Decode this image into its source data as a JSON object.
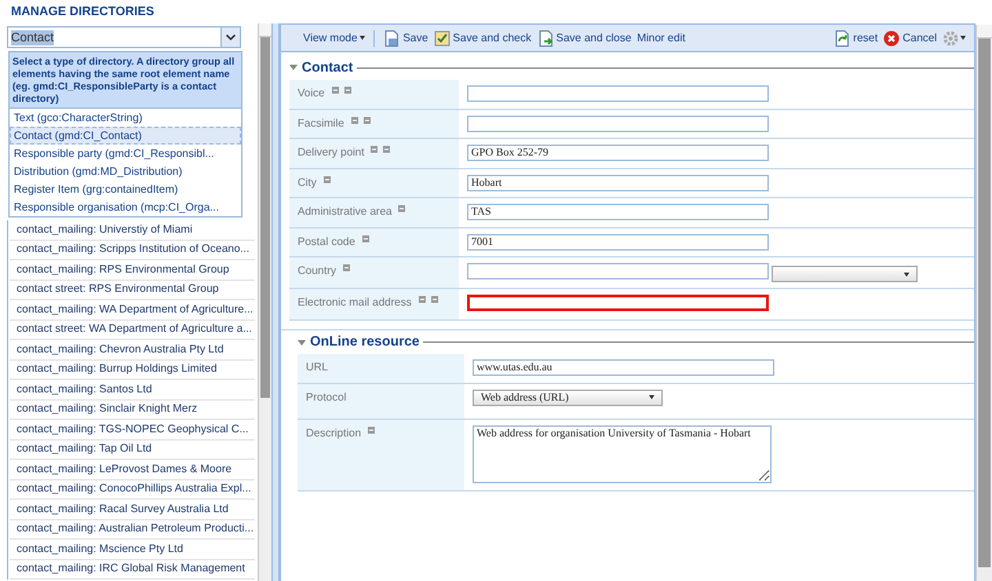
{
  "page_title": "MANAGE DIRECTORIES",
  "directory_type": {
    "value": "Contact",
    "hint": "Select a type of directory. A directory group all elements having the same root element name (eg. gmd:CI_ResponsibleParty is a contact directory)",
    "options": [
      {
        "label": "Text (gco:CharacterString)",
        "selected": false
      },
      {
        "label": "Contact (gmd:CI_Contact)",
        "selected": true
      },
      {
        "label": "Responsible party (gmd:CI_Responsibl...",
        "selected": false
      },
      {
        "label": "Distribution (gmd:MD_Distribution)",
        "selected": false
      },
      {
        "label": "Register Item (grg:containedItem)",
        "selected": false
      },
      {
        "label": "Responsible organisation (mcp:CI_Orga...",
        "selected": false
      }
    ]
  },
  "entries": [
    "contact_mailing: Universtiy of Miami",
    "contact_mailing: Scripps Institution of Oceano...",
    "contact_mailing: RPS Environmental Group",
    "contact street: RPS Environmental Group",
    "contact_mailing: WA Department of Agriculture...",
    "contact street: WA Department of Agriculture a...",
    "contact_mailing: Chevron Australia Pty Ltd",
    "contact_mailing: Burrup Holdings Limited",
    "contact_mailing: Santos Ltd",
    "contact_mailing: Sinclair Knight Merz",
    "contact_mailing: TGS-NOPEC Geophysical C...",
    "contact_mailing: Tap Oil Ltd",
    "contact_mailing: LeProvost Dames & Moore",
    "contact_mailing: ConocoPhillips Australia Expl...",
    "contact_mailing: Racal Survey Australia Ltd",
    "contact_mailing: Australian Petroleum Producti...",
    "contact_mailing: Mscience Pty Ltd",
    "contact_mailing: IRC Global Risk Management"
  ],
  "toolbar": {
    "view_mode": "View mode",
    "save": "Save",
    "save_and_check": "Save and check",
    "save_and_close": "Save and close",
    "minor_edit": "Minor edit",
    "reset": "reset",
    "cancel": "Cancel"
  },
  "sections": [
    {
      "title": "Contact",
      "expanded": true,
      "fields": [
        {
          "kind": "text",
          "label": "Voice",
          "can_add": true,
          "can_remove": true,
          "invalid": false
        },
        {
          "kind": "text",
          "label": "Facsimile",
          "can_add": true,
          "can_remove": true,
          "invalid": false
        },
        {
          "kind": "text",
          "label": "Delivery point",
          "value": "GPO Box 252-79",
          "can_add": true,
          "can_remove": true,
          "invalid": false
        },
        {
          "kind": "text",
          "label": "City",
          "value": "Hobart",
          "can_add": false,
          "can_remove": true,
          "invalid": false
        },
        {
          "kind": "text",
          "label": "Administrative area",
          "value": "TAS",
          "can_add": false,
          "can_remove": true,
          "invalid": false
        },
        {
          "kind": "text",
          "label": "Postal code",
          "value": "7001",
          "can_add": false,
          "can_remove": true,
          "invalid": false
        },
        {
          "kind": "text-with-select",
          "label": "Country",
          "can_add": false,
          "can_remove": true,
          "invalid": false
        },
        {
          "kind": "text",
          "label": "Electronic mail address",
          "can_add": true,
          "can_remove": true,
          "invalid": true
        }
      ]
    },
    {
      "title": "OnLine resource",
      "expanded": true,
      "fields": [
        {
          "kind": "text",
          "label": "URL",
          "value": "www.utas.edu.au",
          "can_add": false,
          "can_remove": false,
          "invalid": false
        },
        {
          "kind": "select",
          "label": "Protocol",
          "value": "Web address (URL)",
          "can_add": false,
          "can_remove": false
        },
        {
          "kind": "textarea",
          "label": "Description",
          "value": "Web address for organisation University of Tasmania - Hobart",
          "can_add": false,
          "can_remove": true
        }
      ]
    }
  ]
}
